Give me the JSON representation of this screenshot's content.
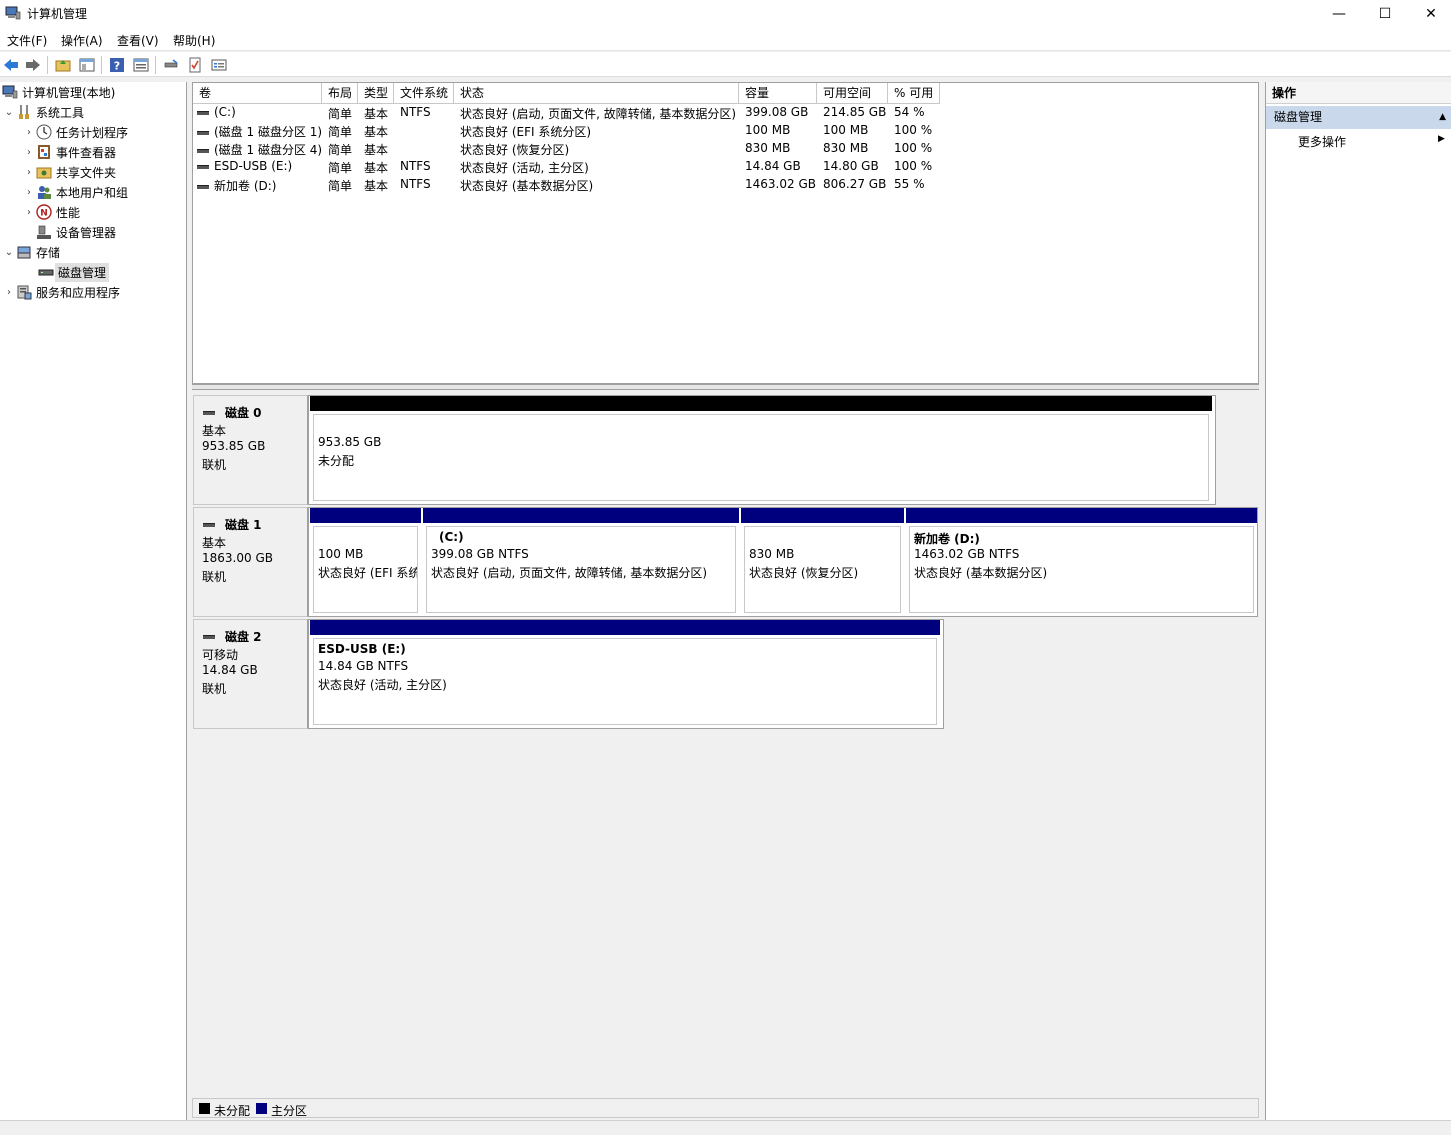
{
  "window": {
    "title": "计算机管理",
    "min_glyph": "—",
    "max_glyph": "☐",
    "close_glyph": "✕"
  },
  "menu": [
    "文件(F)",
    "操作(A)",
    "查看(V)",
    "帮助(H)"
  ],
  "toolbar_icons": [
    "back-icon",
    "forward-icon",
    "up-folder-icon",
    "show-hide-tree-icon",
    "help-icon",
    "properties-icon",
    "connect-icon",
    "check-icon",
    "list-icon"
  ],
  "tree": {
    "root": "计算机管理(本地)",
    "system_tools": "系统工具",
    "task_scheduler": "任务计划程序",
    "event_viewer": "事件查看器",
    "shared_folders": "共享文件夹",
    "local_users": "本地用户和组",
    "performance": "性能",
    "device_manager": "设备管理器",
    "storage": "存储",
    "disk_management": "磁盘管理",
    "services_apps": "服务和应用程序"
  },
  "volumes": {
    "columns": [
      "卷",
      "布局",
      "类型",
      "文件系统",
      "状态",
      "容量",
      "可用空间",
      "% 可用"
    ],
    "rows": [
      [
        "(C:)",
        "简单",
        "基本",
        "NTFS",
        "状态良好 (启动, 页面文件, 故障转储, 基本数据分区)",
        "399.08 GB",
        "214.85 GB",
        "54 %"
      ],
      [
        "(磁盘 1 磁盘分区 1)",
        "简单",
        "基本",
        "",
        "状态良好 (EFI 系统分区)",
        "100 MB",
        "100 MB",
        "100 %"
      ],
      [
        "(磁盘 1 磁盘分区 4)",
        "简单",
        "基本",
        "",
        "状态良好 (恢复分区)",
        "830 MB",
        "830 MB",
        "100 %"
      ],
      [
        "ESD-USB (E:)",
        "简单",
        "基本",
        "NTFS",
        "状态良好 (活动, 主分区)",
        "14.84 GB",
        "14.80 GB",
        "100 %"
      ],
      [
        "新加卷 (D:)",
        "简单",
        "基本",
        "NTFS",
        "状态良好 (基本数据分区)",
        "1463.02 GB",
        "806.27 GB",
        "55 %"
      ]
    ]
  },
  "disks": {
    "disk0": {
      "name": "磁盘 0",
      "type": "基本",
      "size": "953.85 GB",
      "status": "联机",
      "p0": {
        "line1": "953.85 GB",
        "line2": "未分配"
      }
    },
    "disk1": {
      "name": "磁盘 1",
      "type": "基本",
      "size": "1863.00 GB",
      "status": "联机",
      "p0": {
        "line1": "100 MB",
        "line2": "状态良好 (EFI 系统分区)"
      },
      "p1": {
        "title": "(C:)",
        "line1": "399.08 GB NTFS",
        "line2": "状态良好 (启动, 页面文件, 故障转储, 基本数据分区)"
      },
      "p2": {
        "line1": "830 MB",
        "line2": "状态良好 (恢复分区)"
      },
      "p3": {
        "title": "新加卷  (D:)",
        "line1": "1463.02 GB NTFS",
        "line2": "状态良好 (基本数据分区)"
      }
    },
    "disk2": {
      "name": "磁盘 2",
      "type": "可移动",
      "size": "14.84 GB",
      "status": "联机",
      "p0": {
        "title": "ESD-USB  (E:)",
        "line1": "14.84 GB NTFS",
        "line2": "状态良好 (活动, 主分区)"
      }
    }
  },
  "legend": {
    "unallocated": "未分配",
    "primary": "主分区"
  },
  "colors": {
    "unallocated": "#000000",
    "primary": "#00007f",
    "selected_section": "#c9d8ea"
  },
  "actions": {
    "header": "操作",
    "section": "磁盘管理",
    "more": "更多操作"
  }
}
